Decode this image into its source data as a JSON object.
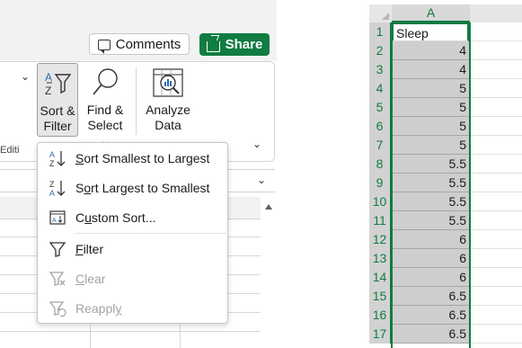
{
  "toolbar": {
    "comments_label": "Comments",
    "share_label": "Share",
    "share_color": "#107c41"
  },
  "ribbon": {
    "sort_filter": {
      "line1": "Sort &",
      "line2": "Filter"
    },
    "find_select": {
      "line1": "Find &",
      "line2": "Select"
    },
    "analyze_data": {
      "line1": "Analyze",
      "line2": "Data"
    },
    "group_label": "Editi"
  },
  "menu": {
    "items": [
      {
        "label_pre": "",
        "label_u": "S",
        "label_post": "ort Smallest to Largest",
        "icon": "sort-ascending-icon",
        "enabled": true
      },
      {
        "label_pre": "S",
        "label_u": "o",
        "label_post": "rt Largest to Smallest",
        "icon": "sort-descending-icon",
        "enabled": true
      },
      {
        "label_pre": "C",
        "label_u": "u",
        "label_post": "stom Sort...",
        "icon": "custom-sort-icon",
        "enabled": true
      },
      {
        "label_pre": "",
        "label_u": "F",
        "label_post": "ilter",
        "icon": "filter-icon",
        "enabled": true
      },
      {
        "label_pre": "",
        "label_u": "C",
        "label_post": "lear",
        "icon": "clear-filter-icon",
        "enabled": false
      },
      {
        "label_pre": "Reappl",
        "label_u": "y",
        "label_post": "",
        "icon": "reapply-icon",
        "enabled": false
      }
    ]
  },
  "sheet": {
    "column_header": "A",
    "accent": "#107c41",
    "rows": [
      {
        "n": "1",
        "value": "Sleep"
      },
      {
        "n": "2",
        "value": "4"
      },
      {
        "n": "3",
        "value": "4"
      },
      {
        "n": "4",
        "value": "5"
      },
      {
        "n": "5",
        "value": "5"
      },
      {
        "n": "6",
        "value": "5"
      },
      {
        "n": "7",
        "value": "5"
      },
      {
        "n": "8",
        "value": "5.5"
      },
      {
        "n": "9",
        "value": "5.5"
      },
      {
        "n": "10",
        "value": "5.5"
      },
      {
        "n": "11",
        "value": "5.5"
      },
      {
        "n": "12",
        "value": "6"
      },
      {
        "n": "13",
        "value": "6"
      },
      {
        "n": "14",
        "value": "6"
      },
      {
        "n": "15",
        "value": "6.5"
      },
      {
        "n": "16",
        "value": "6.5"
      },
      {
        "n": "17",
        "value": "6.5"
      }
    ]
  }
}
